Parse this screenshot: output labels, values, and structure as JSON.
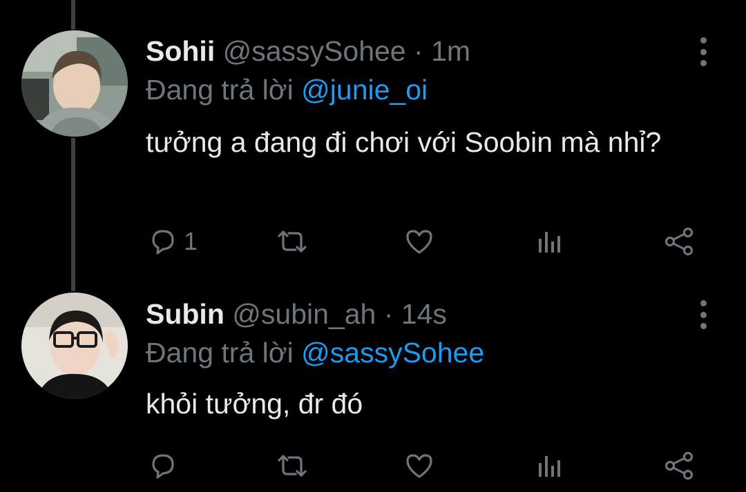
{
  "tweets": [
    {
      "name": "Sohii",
      "handle": "@sassySohee",
      "separator": "·",
      "time": "1m",
      "reply_prefix": "Đang trả lời",
      "reply_to": "@junie_oi",
      "text": "tưởng a đang đi chơi với Soobin mà nhỉ?",
      "reply_count": "1"
    },
    {
      "name": "Subin",
      "handle": "@subin_ah",
      "separator": "·",
      "time": "14s",
      "reply_prefix": "Đang trả lời",
      "reply_to": "@sassySohee",
      "text": "khỏi tưởng, đr đó",
      "reply_count": ""
    }
  ],
  "icons": [
    "reply-icon",
    "retweet-icon",
    "like-icon",
    "analytics-icon",
    "share-icon",
    "more-options-icon"
  ],
  "colors": {
    "background": "#000000",
    "text": "#e7e9ea",
    "secondary": "#6e767d",
    "link": "#1d9bf0",
    "thread_line": "#3d4145"
  }
}
